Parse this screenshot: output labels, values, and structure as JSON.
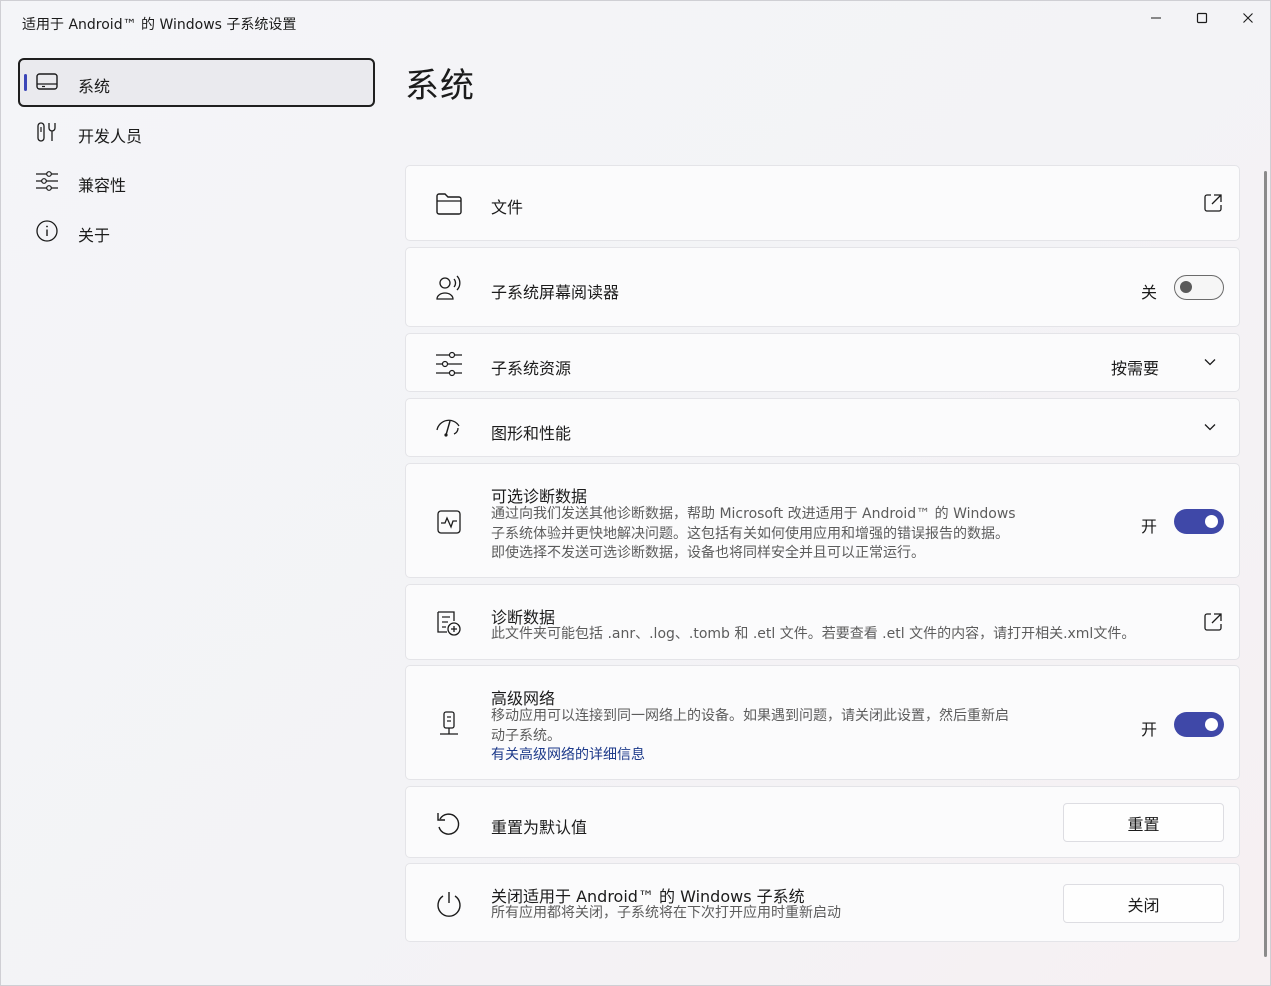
{
  "window": {
    "title": "适用于 Android™ 的 Windows 子系统设置"
  },
  "sidebar": {
    "items": [
      {
        "label": "系统",
        "icon": "display-icon",
        "active": true
      },
      {
        "label": "开发人员",
        "icon": "developer-tools-icon",
        "active": false
      },
      {
        "label": "兼容性",
        "icon": "sliders-icon",
        "active": false
      },
      {
        "label": "关于",
        "icon": "info-icon",
        "active": false
      }
    ]
  },
  "main": {
    "title": "系统",
    "files": {
      "title": "文件",
      "icon": "folder-icon"
    },
    "screen_reader": {
      "title": "子系统屏幕阅读器",
      "state": "关",
      "on": false,
      "icon": "screen-reader-icon"
    },
    "resources": {
      "title": "子系统资源",
      "value": "按需要",
      "icon": "sliders-icon"
    },
    "graphics": {
      "title": "图形和性能",
      "icon": "performance-icon"
    },
    "optional_diag": {
      "title": "可选诊断数据",
      "desc": [
        "通过向我们发送其他诊断数据，帮助 Microsoft 改进适用于 Android™ 的 Windows",
        "子系统体验并更快地解决问题。这包括有关如何使用应用和增强的错误报告的数据。",
        "即使选择不发送可选诊断数据，设备也将同样安全并且可以正常运行。"
      ],
      "state": "开",
      "on": true,
      "icon": "activity-icon"
    },
    "diag_data": {
      "title": "诊断数据",
      "desc": "此文件夹可能包括 .anr、.log、.tomb 和 .etl 文件。若要查看 .etl 文件的内容，请打开相关.xml文件。",
      "icon": "diagnostic-data-icon"
    },
    "adv_network": {
      "title": "高级网络",
      "desc": [
        "移动应用可以连接到同一网络上的设备。如果遇到问题，请关闭此设置，然后重新启",
        "动子系统。"
      ],
      "link": "有关高级网络的详细信息",
      "state": "开",
      "on": true,
      "icon": "network-icon"
    },
    "reset": {
      "title": "重置为默认值",
      "button": "重置",
      "icon": "reset-icon"
    },
    "shutdown": {
      "title": "关闭适用于 Android™ 的 Windows 子系统",
      "desc": "所有应用都将关闭，子系统将在下次打开应用时重新启动",
      "button": "关闭",
      "icon": "power-icon"
    }
  },
  "colors": {
    "accent": "#3f48a8",
    "link": "#1d3a8a",
    "indicator": "#3b46b8"
  }
}
